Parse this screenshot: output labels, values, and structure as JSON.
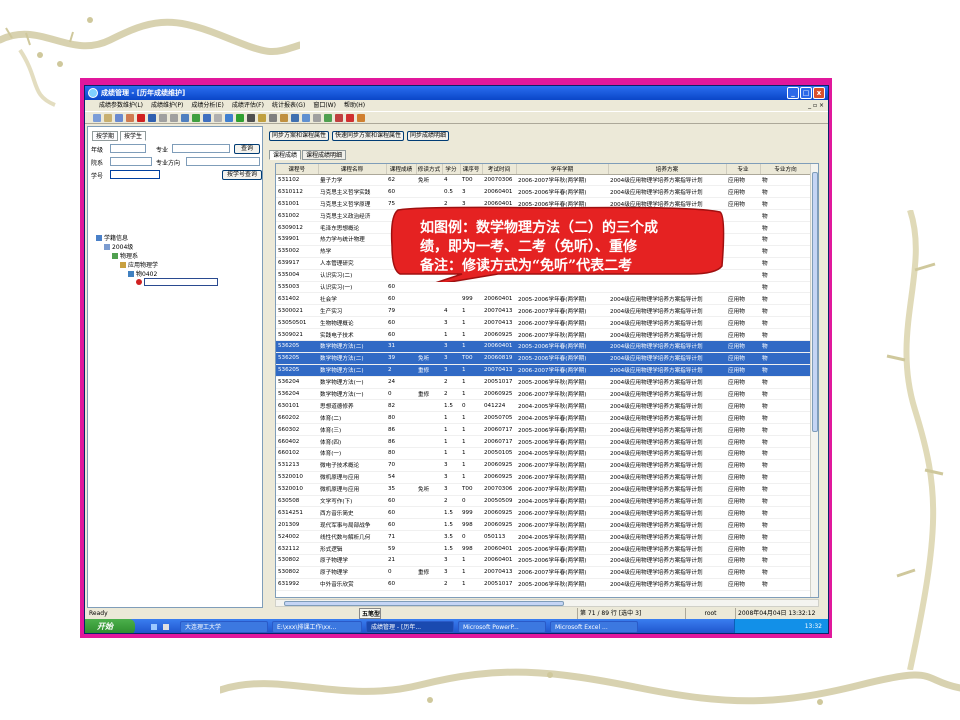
{
  "window": {
    "title": "成绩管理 - [历年成绩维护]",
    "controls": [
      "_",
      "□",
      "x"
    ]
  },
  "menu": {
    "items": [
      "成绩参数维护(L)",
      "成绩维护(P)",
      "成绩分析(E)",
      "成绩评估(F)",
      "统计报表(G)",
      "窗口(W)",
      "帮助(H)"
    ],
    "mdi_controls": "_ ▫ ×"
  },
  "left": {
    "tabs": [
      "按学期",
      "按学生"
    ],
    "labels": {
      "grade": "年级",
      "major": "专业",
      "dept": "院系",
      "direction": "专业方向",
      "student_no": "学号"
    },
    "buttons": {
      "query": "查询",
      "query_by_no": "按学号查询"
    },
    "tree": {
      "root": "学籍信息",
      "year": "2004级",
      "dept": "物理系",
      "major": "应用物理学",
      "class": "物0402"
    }
  },
  "right": {
    "toolbar_buttons": [
      "同步方案和课程属性",
      "快速同步方案和课程属性",
      "同步成绩明细"
    ],
    "tabs": [
      "课程成绩",
      "课程成绩明细"
    ],
    "columns": [
      "课程号",
      "课程名称",
      "课程成绩",
      "修读方式",
      "学分",
      "课序号",
      "考试时间",
      "学年学期",
      "培养方案",
      "专业",
      "专业方向"
    ],
    "rows": [
      [
        "531102",
        "量子力学",
        "62",
        "免听",
        "4",
        "T00",
        "20070306",
        "2006-2007学年秋(两学期)",
        "2004级应用物理学培养方案指导计划",
        "应用物",
        "物"
      ],
      [
        "6310112",
        "马克思主义哲学实践",
        "60",
        "",
        "0.5",
        "3",
        "20060401",
        "2005-2006学年春(两学期)",
        "2004级应用物理学培养方案指导计划",
        "应用物",
        "物"
      ],
      [
        "631001",
        "马克思主义哲学原理",
        "75",
        "",
        "2",
        "3",
        "20060401",
        "2005-2006学年春(两学期)",
        "2004级应用物理学培养方案指导计划",
        "应用物",
        "物"
      ],
      [
        "631002",
        "马克思主义政治经济",
        "",
        "",
        "",
        "",
        "",
        "",
        "",
        "",
        "物"
      ],
      [
        "6309012",
        "毛泽东思想概论",
        "",
        "",
        "",
        "",
        "",
        "",
        "",
        "",
        "物"
      ],
      [
        "539901",
        "热力学与统计物理",
        "",
        "",
        "",
        "",
        "",
        "",
        "",
        "",
        "物"
      ],
      [
        "535002",
        "热学",
        "",
        "",
        "",
        "",
        "",
        "",
        "",
        "",
        "物"
      ],
      [
        "639917",
        "人本管理研究",
        "",
        "",
        "",
        "",
        "",
        "",
        "",
        "",
        "物"
      ],
      [
        "535004",
        "认识实习(二)",
        "",
        "",
        "",
        "",
        "",
        "",
        "",
        "",
        "物"
      ],
      [
        "535003",
        "认识实习(一)",
        "60",
        "",
        "",
        "",
        "",
        "",
        "",
        "",
        "物"
      ],
      [
        "631402",
        "社会学",
        "60",
        "",
        "",
        "999",
        "20060401",
        "2005-2006学年春(两学期)",
        "2004级应用物理学培养方案指导计划",
        "应用物",
        "物"
      ],
      [
        "5300021",
        "生产实习",
        "79",
        "",
        "4",
        "1",
        "20070413",
        "2006-2007学年春(两学期)",
        "2004级应用物理学培养方案指导计划",
        "应用物",
        "物"
      ],
      [
        "53050501",
        "生物物理概论",
        "60",
        "",
        "3",
        "1",
        "20070413",
        "2006-2007学年春(两学期)",
        "2004级应用物理学培养方案指导计划",
        "应用物",
        "物"
      ],
      [
        "5309021",
        "实践电子技术",
        "60",
        "",
        "1",
        "1",
        "20060925",
        "2006-2007学年秋(两学期)",
        "2004级应用物理学培养方案指导计划",
        "应用物",
        "物"
      ],
      [
        "536205",
        "数学物理方法(二)",
        "31",
        "",
        "3",
        "1",
        "20060401",
        "2005-2006学年春(两学期)",
        "2004级应用物理学培养方案指导计划",
        "应用物",
        "物"
      ],
      [
        "536205",
        "数学物理方法(二)",
        "39",
        "免听",
        "3",
        "T00",
        "20060819",
        "2005-2006学年春(两学期)",
        "2004级应用物理学培养方案指导计划",
        "应用物",
        "物"
      ],
      [
        "536205",
        "数学物理方法(二)",
        "2",
        "重修",
        "3",
        "1",
        "20070413",
        "2006-2007学年春(两学期)",
        "2004级应用物理学培养方案指导计划",
        "应用物",
        "物"
      ],
      [
        "536204",
        "数学物理方法(一)",
        "24",
        "",
        "2",
        "1",
        "20051017",
        "2005-2006学年秋(两学期)",
        "2004级应用物理学培养方案指导计划",
        "应用物",
        "物"
      ],
      [
        "536204",
        "数学物理方法(一)",
        "0",
        "重修",
        "2",
        "1",
        "20060925",
        "2006-2007学年秋(两学期)",
        "2004级应用物理学培养方案指导计划",
        "应用物",
        "物"
      ],
      [
        "630101",
        "思想道德修养",
        "82",
        "",
        "1.5",
        "0",
        "041224",
        "2004-2005学年秋(两学期)",
        "2004级应用物理学培养方案指导计划",
        "应用物",
        "物"
      ],
      [
        "660202",
        "体育(二)",
        "80",
        "",
        "1",
        "1",
        "20050705",
        "2004-2005学年春(两学期)",
        "2004级应用物理学培养方案指导计划",
        "应用物",
        "物"
      ],
      [
        "660302",
        "体育(三)",
        "86",
        "",
        "1",
        "1",
        "20060717",
        "2005-2006学年春(两学期)",
        "2004级应用物理学培养方案指导计划",
        "应用物",
        "物"
      ],
      [
        "660402",
        "体育(四)",
        "86",
        "",
        "1",
        "1",
        "20060717",
        "2005-2006学年春(两学期)",
        "2004级应用物理学培养方案指导计划",
        "应用物",
        "物"
      ],
      [
        "660102",
        "体育(一)",
        "80",
        "",
        "1",
        "1",
        "20050105",
        "2004-2005学年秋(两学期)",
        "2004级应用物理学培养方案指导计划",
        "应用物",
        "物"
      ],
      [
        "531213",
        "微电子技术概论",
        "70",
        "",
        "3",
        "1",
        "20060925",
        "2006-2007学年秋(两学期)",
        "2004级应用物理学培养方案指导计划",
        "应用物",
        "物"
      ],
      [
        "5320010",
        "微机原理与应用",
        "54",
        "",
        "3",
        "1",
        "20060925",
        "2006-2007学年秋(两学期)",
        "2004级应用物理学培养方案指导计划",
        "应用物",
        "物"
      ],
      [
        "5320010",
        "微机原理与应用",
        "35",
        "免听",
        "3",
        "T00",
        "20070306",
        "2006-2007学年秋(两学期)",
        "2004级应用物理学培养方案指导计划",
        "应用物",
        "物"
      ],
      [
        "630508",
        "文学写作(下)",
        "60",
        "",
        "2",
        "0",
        "20050509",
        "2004-2005学年春(两学期)",
        "2004级应用物理学培养方案指导计划",
        "应用物",
        "物"
      ],
      [
        "6314251",
        "西方音乐简史",
        "60",
        "",
        "1.5",
        "999",
        "20060925",
        "2006-2007学年秋(两学期)",
        "2004级应用物理学培养方案指导计划",
        "应用物",
        "物"
      ],
      [
        "201309",
        "现代军事与局部战争",
        "60",
        "",
        "1.5",
        "998",
        "20060925",
        "2006-2007学年秋(两学期)",
        "2004级应用物理学培养方案指导计划",
        "应用物",
        "物"
      ],
      [
        "524002",
        "线性代数与解析几何",
        "71",
        "",
        "3.5",
        "0",
        "050113",
        "2004-2005学年秋(两学期)",
        "2004级应用物理学培养方案指导计划",
        "应用物",
        "物"
      ],
      [
        "632112",
        "形式逻辑",
        "59",
        "",
        "1.5",
        "998",
        "20060401",
        "2005-2006学年春(两学期)",
        "2004级应用物理学培养方案指导计划",
        "应用物",
        "物"
      ],
      [
        "530802",
        "原子物理学",
        "21",
        "",
        "3",
        "1",
        "20060401",
        "2005-2006学年春(两学期)",
        "2004级应用物理学培养方案指导计划",
        "应用物",
        "物"
      ],
      [
        "530802",
        "原子物理学",
        "0",
        "重修",
        "3",
        "1",
        "20070413",
        "2006-2007学年春(两学期)",
        "2004级应用物理学培养方案指导计划",
        "应用物",
        "物"
      ],
      [
        "631992",
        "中外音乐欣赏",
        "60",
        "",
        "2",
        "1",
        "20051017",
        "2005-2006学年秋(两学期)",
        "2004级应用物理学培养方案指导计划",
        "应用物",
        "物"
      ]
    ]
  },
  "status": {
    "ready": "Ready",
    "ime": "五笔型",
    "record": "第 71 / 89 行 [选中 3]",
    "user": "root",
    "datetime": "2008年04月04日 13:32:12"
  },
  "taskbar": {
    "start": "开始",
    "tasks": [
      "大连理工大学",
      "E:\\xxx\\排课工作\\xx...",
      "成绩管理 - [历年...",
      "Microsoft PowerP...",
      "Microsoft Excel ..."
    ],
    "clock": "13:32"
  },
  "callout": {
    "lines": [
      "如图例：数学物理方法（二）的三个成",
      "绩，即为一考、二考（免听）、重修",
      "备注：修读方式为“免听”代表二考"
    ]
  }
}
